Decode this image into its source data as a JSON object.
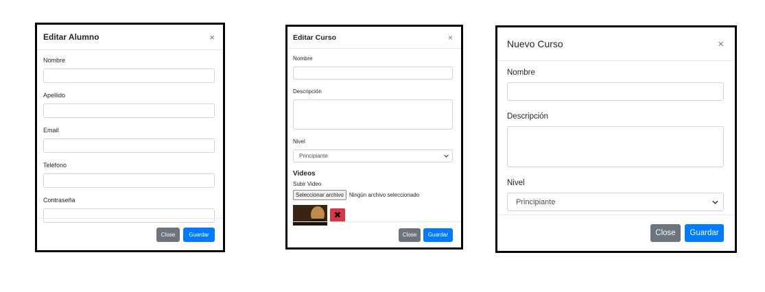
{
  "edit_student": {
    "title": "Editar Alumno",
    "close_symbol": "×",
    "fields": [
      {
        "label": "Nombre",
        "value": ""
      },
      {
        "label": "Apellido",
        "value": ""
      },
      {
        "label": "Email",
        "value": ""
      },
      {
        "label": "Teléfono",
        "value": ""
      },
      {
        "label": "Contraseña",
        "value": ""
      }
    ],
    "close_label": "Close",
    "save_label": "Guardar"
  },
  "edit_course": {
    "title": "Editar Curso",
    "close_symbol": "×",
    "name_label": "Nombre",
    "description_label": "Descripción",
    "level_label": "Nivel",
    "level_selected": "Principiante",
    "videos_title": "Videos",
    "upload_label": "Subir Video",
    "file_button": "Seleccionar archivo",
    "file_status": "Ningún archivo seleccionado",
    "delete_symbol": "✖",
    "close_label": "Close",
    "save_label": "Guardar"
  },
  "new_course": {
    "title": "Nuevo Curso",
    "close_symbol": "×",
    "name_label": "Nombre",
    "description_label": "Descripción",
    "level_label": "Nivel",
    "level_selected": "Principiante",
    "close_label": "Close",
    "save_label": "Guardar"
  },
  "icons": {
    "close": "close-icon",
    "chevron": "chevron-down-icon",
    "delete": "delete-icon",
    "thumbnail": "video-thumbnail"
  },
  "colors": {
    "primary": "#007bff",
    "secondary": "#6c757d",
    "danger": "#dc3545"
  }
}
